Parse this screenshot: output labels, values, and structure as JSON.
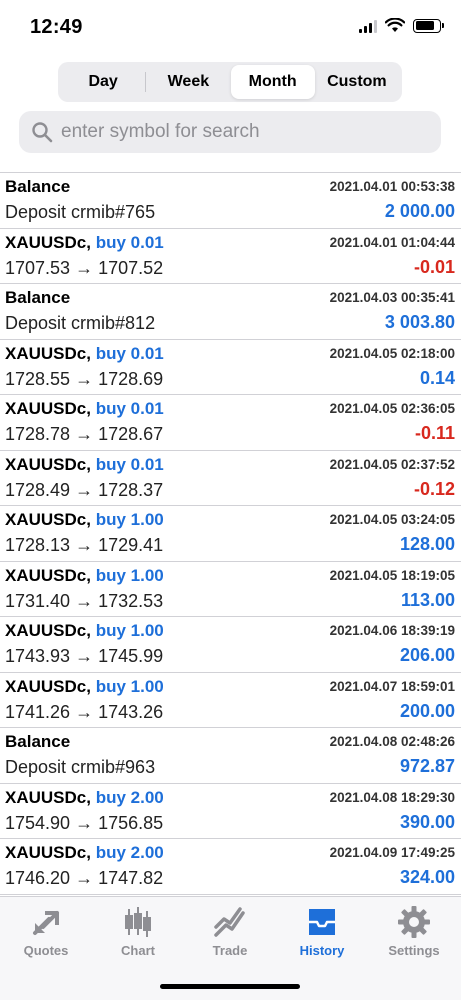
{
  "status": {
    "time": "12:49"
  },
  "periods": [
    {
      "label": "Day",
      "active": false
    },
    {
      "label": "Week",
      "active": false
    },
    {
      "label": "Month",
      "active": true
    },
    {
      "label": "Custom",
      "active": false
    }
  ],
  "search": {
    "placeholder": "enter symbol for search",
    "icon": "search-icon"
  },
  "rows": [
    {
      "title": "Balance",
      "deal": "",
      "sub": "Deposit crmib#765",
      "date": "2021.04.01 00:53:38",
      "profit": "2 000.00",
      "sign": "pos"
    },
    {
      "title": "XAUUSDc,",
      "deal": "buy 0.01",
      "sub": "1707.53 → 1707.52",
      "date": "2021.04.01 01:04:44",
      "profit": "-0.01",
      "sign": "neg"
    },
    {
      "title": "Balance",
      "deal": "",
      "sub": "Deposit crmib#812",
      "date": "2021.04.03 00:35:41",
      "profit": "3 003.80",
      "sign": "pos"
    },
    {
      "title": "XAUUSDc,",
      "deal": "buy 0.01",
      "sub": "1728.55 → 1728.69",
      "date": "2021.04.05 02:18:00",
      "profit": "0.14",
      "sign": "pos"
    },
    {
      "title": "XAUUSDc,",
      "deal": "buy 0.01",
      "sub": "1728.78 → 1728.67",
      "date": "2021.04.05 02:36:05",
      "profit": "-0.11",
      "sign": "neg"
    },
    {
      "title": "XAUUSDc,",
      "deal": "buy 0.01",
      "sub": "1728.49 → 1728.37",
      "date": "2021.04.05 02:37:52",
      "profit": "-0.12",
      "sign": "neg"
    },
    {
      "title": "XAUUSDc,",
      "deal": "buy 1.00",
      "sub": "1728.13 → 1729.41",
      "date": "2021.04.05 03:24:05",
      "profit": "128.00",
      "sign": "pos"
    },
    {
      "title": "XAUUSDc,",
      "deal": "buy 1.00",
      "sub": "1731.40 → 1732.53",
      "date": "2021.04.05 18:19:05",
      "profit": "113.00",
      "sign": "pos"
    },
    {
      "title": "XAUUSDc,",
      "deal": "buy 1.00",
      "sub": "1743.93 → 1745.99",
      "date": "2021.04.06 18:39:19",
      "profit": "206.00",
      "sign": "pos"
    },
    {
      "title": "XAUUSDc,",
      "deal": "buy 1.00",
      "sub": "1741.26 → 1743.26",
      "date": "2021.04.07 18:59:01",
      "profit": "200.00",
      "sign": "pos"
    },
    {
      "title": "Balance",
      "deal": "",
      "sub": "Deposit crmib#963",
      "date": "2021.04.08 02:48:26",
      "profit": "972.87",
      "sign": "pos"
    },
    {
      "title": "XAUUSDc,",
      "deal": "buy 2.00",
      "sub": "1754.90 → 1756.85",
      "date": "2021.04.08 18:29:30",
      "profit": "390.00",
      "sign": "pos"
    },
    {
      "title": "XAUUSDc,",
      "deal": "buy 2.00",
      "sub": "1746.20 → 1747.82",
      "date": "2021.04.09 17:49:25",
      "profit": "324.00",
      "sign": "pos"
    }
  ],
  "tabs": [
    {
      "label": "Quotes",
      "icon": "quotes-icon",
      "active": false
    },
    {
      "label": "Chart",
      "icon": "chart-icon",
      "active": false
    },
    {
      "label": "Trade",
      "icon": "trade-icon",
      "active": false
    },
    {
      "label": "History",
      "icon": "history-icon",
      "active": true
    },
    {
      "label": "Settings",
      "icon": "settings-icon",
      "active": false
    }
  ],
  "colors": {
    "accent": "#1e6fd9",
    "negative": "#d8281e",
    "inactive": "#8e8e93"
  }
}
